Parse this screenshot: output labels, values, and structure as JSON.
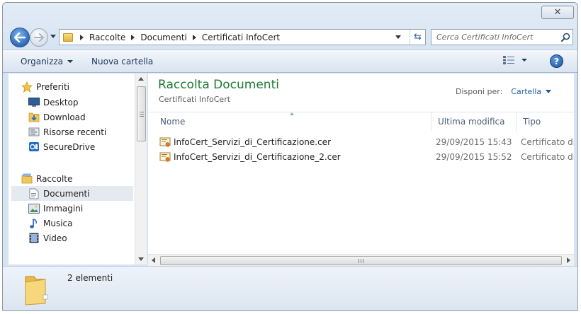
{
  "window": {
    "close_icon": "close-icon"
  },
  "address": {
    "crumbs": [
      "Raccolte",
      "Documenti",
      "Certificati InfoCert"
    ]
  },
  "search": {
    "placeholder": "Cerca Certificati InfoCert"
  },
  "toolbar": {
    "organize_label": "Organizza",
    "new_folder_label": "Nuova cartella"
  },
  "nav": {
    "favorites_label": "Preferiti",
    "favorites": [
      {
        "label": "Desktop",
        "icon": "desktop-icon"
      },
      {
        "label": "Download",
        "icon": "download-folder-icon"
      },
      {
        "label": "Risorse recenti",
        "icon": "recent-places-icon"
      },
      {
        "label": "SecureDrive",
        "icon": "securedrive-icon"
      }
    ],
    "libraries_label": "Raccolte",
    "libraries": [
      {
        "label": "Documenti",
        "icon": "documents-icon",
        "selected": true
      },
      {
        "label": "Immagini",
        "icon": "pictures-icon"
      },
      {
        "label": "Musica",
        "icon": "music-icon"
      },
      {
        "label": "Video",
        "icon": "video-icon"
      }
    ]
  },
  "content": {
    "library_title": "Raccolta Documenti",
    "library_subtitle": "Certificati InfoCert",
    "arrange_label": "Disponi per:",
    "arrange_value": "Cartella",
    "columns": [
      "Nome",
      "Ultima modifica",
      "Tipo"
    ],
    "files": [
      {
        "name": "InfoCert_Servizi_di_Certificazione.cer",
        "modified": "29/09/2015 15:43",
        "type": "Certificato di s"
      },
      {
        "name": "InfoCert_Servizi_di_Certificazione_2.cer",
        "modified": "29/09/2015 15:52",
        "type": "Certificato di s"
      }
    ]
  },
  "details": {
    "item_count": "2 elementi"
  },
  "colors": {
    "accent_title": "#1e7b34",
    "link_blue": "#1e5da6",
    "chrome_bg": "#d6e3f1"
  }
}
